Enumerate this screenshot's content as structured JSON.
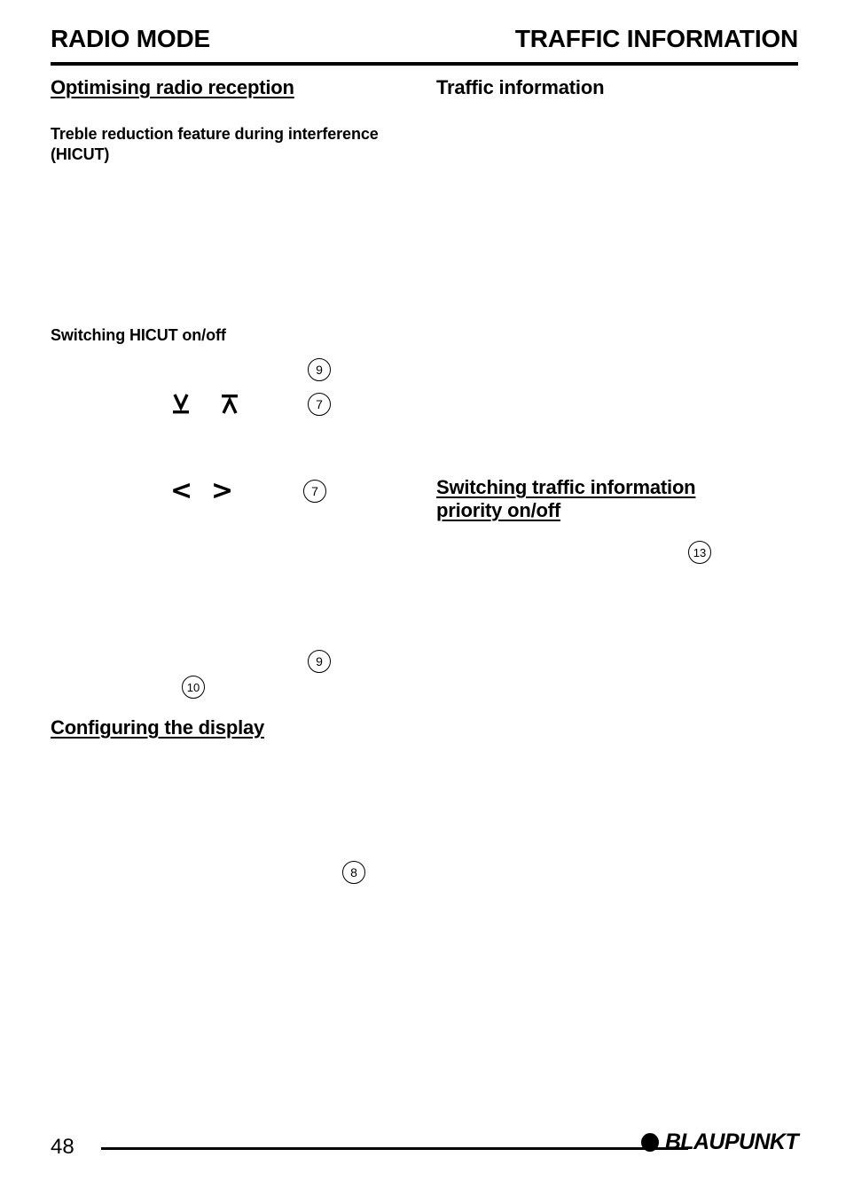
{
  "header": {
    "left_title": "RADIO MODE",
    "right_title": "TRAFFIC INFORMATION"
  },
  "left_column": {
    "section_heading": "Optimising radio reception",
    "subheading_hicut": "Treble reduction feature during interference (HICUT)",
    "subheading_switching_hicut": "Switching HICUT on/off",
    "ref_9_a": "9",
    "ref_7_a": "7",
    "glyph_down": "down-arrow-with-bar",
    "glyph_up": "up-arrow-with-bar",
    "ref_7_b": "7",
    "glyph_left": "<",
    "glyph_right": ">",
    "ref_9_b": "9",
    "ref_10": "10",
    "section_heading_display": "Configuring the display",
    "ref_8": "8"
  },
  "right_column": {
    "section_heading": "Traffic information",
    "subheading_priority": "Switching traffic information priority on/off",
    "ref_13": "13"
  },
  "footer": {
    "page_number": "48",
    "brand_name": "BLAUPUNKT"
  }
}
